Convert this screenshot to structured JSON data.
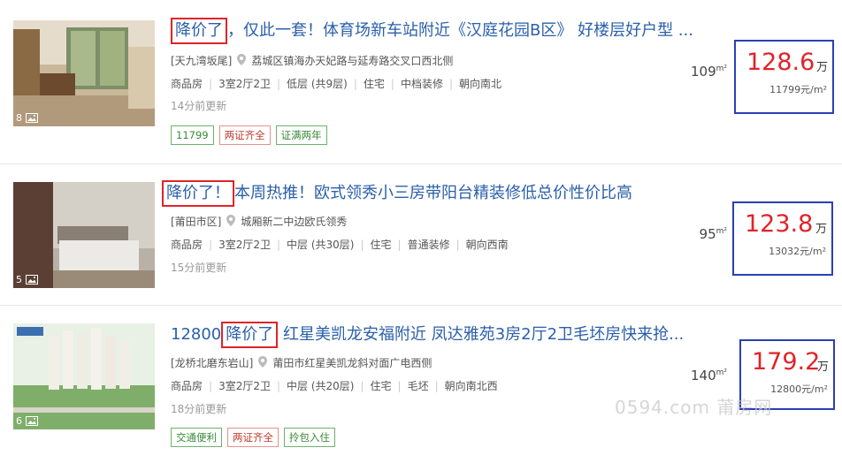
{
  "listings": [
    {
      "photo_count": "8",
      "title_highlight": "降价了",
      "title_rest": "，仅此一套！体育场新车站附近《汉庭花园B区》 好楼层好户型 ...",
      "title_prefix": "",
      "community": "[天九湾坂尾]",
      "address": "荔城区镇海办天妃路与延寿路交叉口西北侧",
      "info": [
        "商品房",
        "3室2厅2卫",
        "低层 (共9层)",
        "住宅",
        "中档装修",
        "朝向南北"
      ],
      "updated": "14分前更新",
      "tags": [
        {
          "text": "11799",
          "color": "green"
        },
        {
          "text": "两证齐全",
          "color": "red"
        },
        {
          "text": "证满两年",
          "color": "green"
        }
      ],
      "area": "109",
      "area_unit": "m²",
      "price": "128.6",
      "price_unit": "万",
      "unit_price": "11799元/m²"
    },
    {
      "photo_count": "5",
      "title_highlight": "降价了！",
      "title_rest": "本周热推！欧式领秀小三房带阳台精装修低总价性价比高",
      "title_prefix": "",
      "community": "[莆田市区]",
      "address": "城厢新二中边欧氏领秀",
      "info": [
        "商品房",
        "3室2厅2卫",
        "中层 (共30层)",
        "住宅",
        "普通装修",
        "朝向西南"
      ],
      "updated": "15分前更新",
      "tags": [],
      "area": "95",
      "area_unit": "m²",
      "price": "123.8",
      "price_unit": "万",
      "unit_price": "13032元/m²"
    },
    {
      "photo_count": "6",
      "title_prefix": "12800",
      "title_highlight": "降价了",
      "title_rest": " 红星美凯龙安福附近 凤达雅苑3房2厅2卫毛坯房快来抢...",
      "community": "[龙桥北磨东岩山]",
      "address": "莆田市红星美凯龙斜对面广电西侧",
      "info": [
        "商品房",
        "3室2厅2卫",
        "中层 (共20层)",
        "住宅",
        "毛坯",
        "朝向南北西"
      ],
      "updated": "18分前更新",
      "tags": [
        {
          "text": "交通便利",
          "color": "green"
        },
        {
          "text": "两证齐全",
          "color": "red"
        },
        {
          "text": "拎包入住",
          "color": "green"
        }
      ],
      "area": "140",
      "area_unit": "m²",
      "price": "179.2",
      "price_unit": "万",
      "unit_price": "12800元/m²"
    }
  ],
  "watermark": "0594.com 莆房网",
  "colors": {
    "title": "#2a5faa",
    "price": "#e0232a",
    "highlight_border": "#e0232a",
    "price_border": "#2b3fb4"
  }
}
